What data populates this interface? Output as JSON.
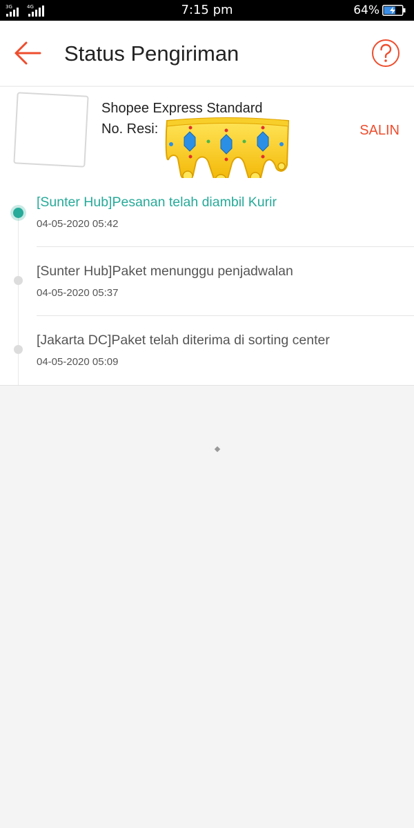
{
  "statusbar": {
    "network_left": "3G",
    "network_right": "4G",
    "time": "7:15 pm",
    "battery_percent": "64%",
    "battery_level": 0.64
  },
  "header": {
    "title": "Status Pengiriman",
    "back_icon": "arrow-left-icon",
    "help_icon": "question-circle-icon"
  },
  "shipment": {
    "courier": "Shopee Express Standard",
    "resi_label": "No. Resi:",
    "copy_label": "SALIN"
  },
  "timeline": [
    {
      "text": "[Sunter Hub]Pesanan telah diambil Kurir",
      "time": "04-05-2020 05:42",
      "active": true
    },
    {
      "text": "[Sunter Hub]Paket menunggu penjadwalan",
      "time": "04-05-2020 05:37",
      "active": false
    },
    {
      "text": "[Jakarta DC]Paket telah diterima di sorting center",
      "time": "04-05-2020 05:09",
      "active": false
    }
  ],
  "colors": {
    "accent": "#ee4d2d",
    "active": "#26aa99",
    "background": "#f4f4f4"
  }
}
